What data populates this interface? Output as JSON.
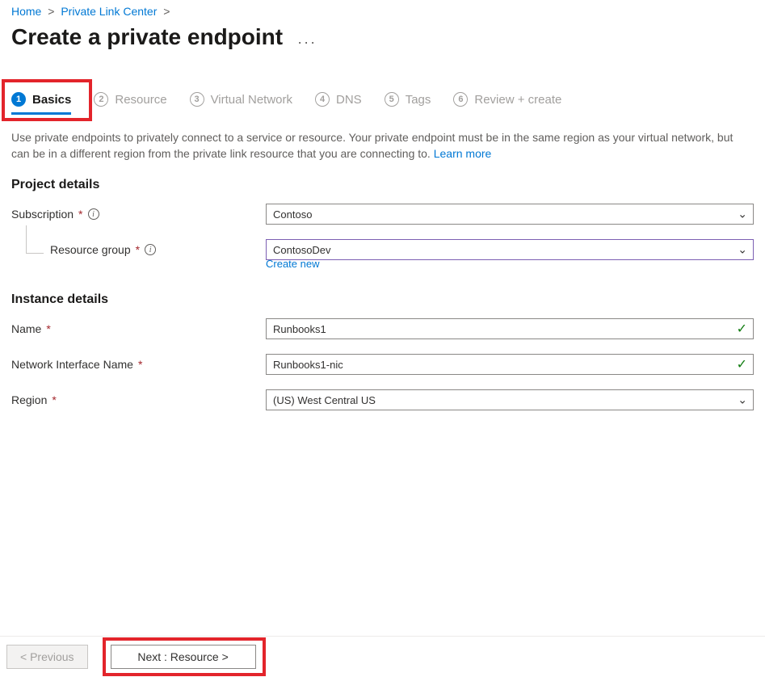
{
  "breadcrumb": {
    "home": "Home",
    "plc": "Private Link Center"
  },
  "title": "Create a private endpoint",
  "tabs": [
    {
      "num": "1",
      "label": "Basics"
    },
    {
      "num": "2",
      "label": "Resource"
    },
    {
      "num": "3",
      "label": "Virtual Network"
    },
    {
      "num": "4",
      "label": "DNS"
    },
    {
      "num": "5",
      "label": "Tags"
    },
    {
      "num": "6",
      "label": "Review + create"
    }
  ],
  "description": "Use private endpoints to privately connect to a service or resource. Your private endpoint must be in the same region as your virtual network, but can be in a different region from the private link resource that you are connecting to.  ",
  "learn_more": "Learn more",
  "sections": {
    "project": "Project details",
    "instance": "Instance details"
  },
  "fields": {
    "subscription_label": "Subscription",
    "resource_group_label": "Resource group",
    "create_new": "Create new",
    "name_label": "Name",
    "nic_label": "Network Interface Name",
    "region_label": "Region"
  },
  "values": {
    "subscription": "Contoso",
    "resource_group": "ContosoDev",
    "name": "Runbooks1",
    "nic": "Runbooks1-nic",
    "region": "(US) West Central US"
  },
  "footer": {
    "previous": "< Previous",
    "next": "Next : Resource >"
  }
}
